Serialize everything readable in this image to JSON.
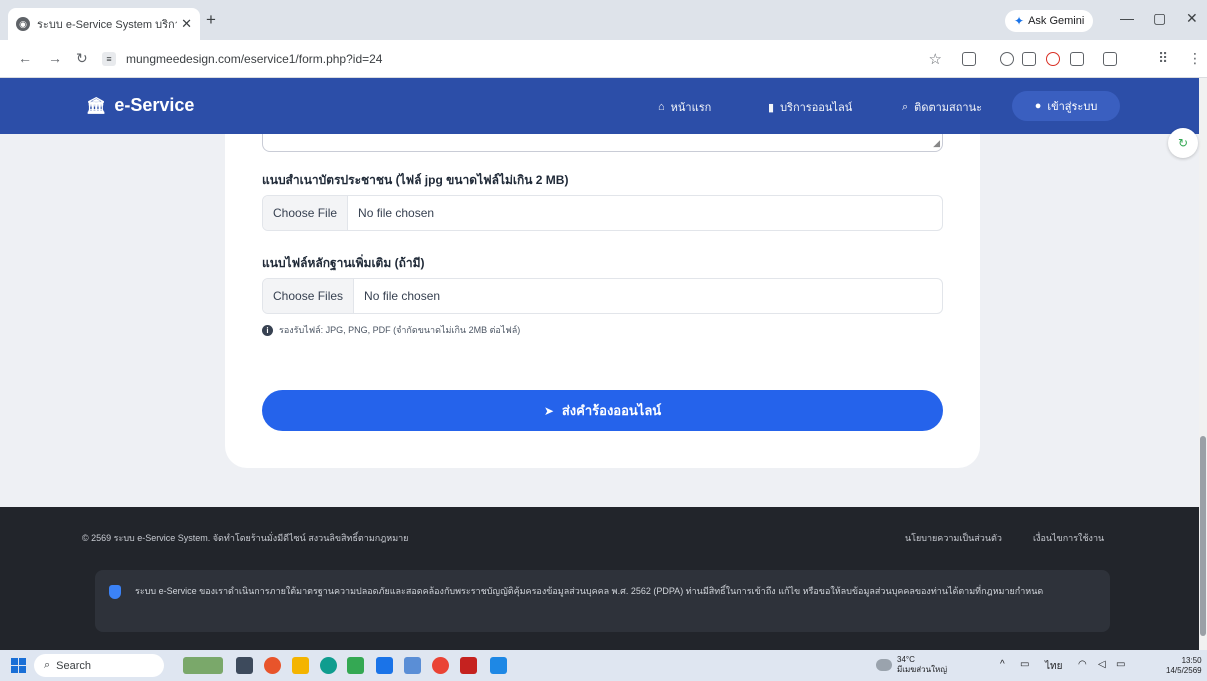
{
  "browser": {
    "tab_title": "ระบบ e-Service System บริการออ...",
    "tab_close": "✕",
    "new_tab": "+",
    "gemini_label": "Ask Gemini",
    "url": "mungmeedesign.com/eservice1/form.php?id=24"
  },
  "header": {
    "brand": "e-Service",
    "nav": {
      "home": "หน้าแรก",
      "services": "บริการออนไลน์",
      "track": "ติดตามสถานะ",
      "login": "เข้าสู่ระบบ"
    }
  },
  "form": {
    "id_card_label": "แนบสำเนาบัตรประชาชน (ไฟล์ jpg ขนาดไฟล์ไม่เกิน 2 MB)",
    "id_card_choose": "Choose File",
    "id_card_status": "No file chosen",
    "evidence_label": "แนบไฟล์หลักฐานเพิ่มเติม (ถ้ามี)",
    "evidence_choose": "Choose Files",
    "evidence_status": "No file chosen",
    "hint": "รองรับไฟล์: JPG, PNG, PDF (จำกัดขนาดไม่เกิน 2MB ต่อไฟล์)",
    "submit_label": "ส่งคำร้องออนไลน์"
  },
  "footer": {
    "copyright": "© 2569 ระบบ e-Service System. จัดทำโดยร้านมั่งมีดีไซน์ สงวนลิขสิทธิ์ตามกฎหมาย",
    "privacy_link": "นโยบายความเป็นส่วนตัว",
    "terms_link": "เงื่อนไขการใช้งาน",
    "pdpa_text": "ระบบ e-Service ของเราดำเนินการภายใต้มาตรฐานความปลอดภัยและสอดคล้องกับพระราชบัญญัติคุ้มครองข้อมูลส่วนบุคคล พ.ศ. 2562 (PDPA) ท่านมีสิทธิ์ในการเข้าถึง แก้ไข หรือขอให้ลบข้อมูลส่วนบุคคลของท่านได้ตามที่กฎหมายกำหนด"
  },
  "taskbar": {
    "search": "Search",
    "temperature": "34°C",
    "weather_desc": "มีเมฆส่วนใหญ่",
    "language": "ไทย",
    "time": "13:50",
    "date": "14/5/2569"
  },
  "colors": {
    "header_bg": "#2c4ea8",
    "submit_bg": "#2563eb",
    "footer_bg": "#22252b"
  }
}
